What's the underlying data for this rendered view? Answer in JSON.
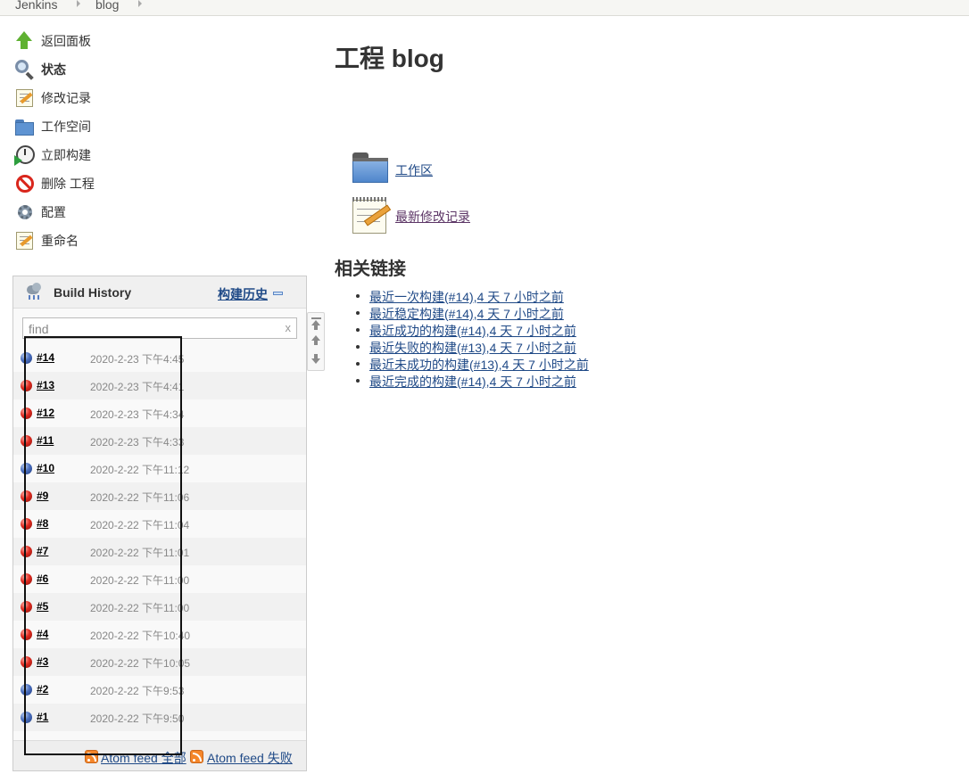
{
  "breadcrumb": [
    "Jenkins",
    "blog"
  ],
  "sidebar": {
    "tasks": [
      {
        "label": "返回面板",
        "icon": "up-arrow-icon",
        "bold": false
      },
      {
        "label": "状态",
        "icon": "magnifier-icon",
        "bold": true
      },
      {
        "label": "修改记录",
        "icon": "notepad-icon",
        "bold": false
      },
      {
        "label": "工作空间",
        "icon": "folder-icon",
        "bold": false
      },
      {
        "label": "立即构建",
        "icon": "clock-icon",
        "bold": false
      },
      {
        "label": "删除 工程",
        "icon": "no-entry-icon",
        "bold": false
      },
      {
        "label": "配置",
        "icon": "gear-icon",
        "bold": false
      },
      {
        "label": "重命名",
        "icon": "notepad-icon",
        "bold": false
      }
    ]
  },
  "build_history": {
    "title": "Build History",
    "trend_label": "构建历史",
    "find_placeholder": "find",
    "clear_label": "x",
    "builds": [
      {
        "number": "#14",
        "time": "2020-2-23 下午4:45",
        "status": "blue"
      },
      {
        "number": "#13",
        "time": "2020-2-23 下午4:41",
        "status": "red"
      },
      {
        "number": "#12",
        "time": "2020-2-23 下午4:34",
        "status": "red"
      },
      {
        "number": "#11",
        "time": "2020-2-23 下午4:33",
        "status": "red"
      },
      {
        "number": "#10",
        "time": "2020-2-22 下午11:12",
        "status": "blue"
      },
      {
        "number": "#9",
        "time": "2020-2-22 下午11:06",
        "status": "red"
      },
      {
        "number": "#8",
        "time": "2020-2-22 下午11:04",
        "status": "red"
      },
      {
        "number": "#7",
        "time": "2020-2-22 下午11:01",
        "status": "red"
      },
      {
        "number": "#6",
        "time": "2020-2-22 下午11:00",
        "status": "red"
      },
      {
        "number": "#5",
        "time": "2020-2-22 下午11:00",
        "status": "red"
      },
      {
        "number": "#4",
        "time": "2020-2-22 下午10:40",
        "status": "red"
      },
      {
        "number": "#3",
        "time": "2020-2-22 下午10:05",
        "status": "red"
      },
      {
        "number": "#2",
        "time": "2020-2-22 下午9:53",
        "status": "blue"
      },
      {
        "number": "#1",
        "time": "2020-2-22 下午9:50",
        "status": "blue"
      }
    ],
    "feed_all": "Atom feed 全部",
    "feed_failures": "Atom feed 失败"
  },
  "main": {
    "title": "工程 blog",
    "workspace_link": "工作区",
    "changes_link": "最新修改记录",
    "related_title": "相关链接",
    "related_links": [
      "最近一次构建(#14),4 天 7 小时之前",
      "最近稳定构建(#14),4 天 7 小时之前",
      "最近成功的构建(#14),4 天 7 小时之前",
      "最近失败的构建(#13),4 天 7 小时之前",
      "最近未成功的构建(#13),4 天 7 小时之前",
      "最近完成的构建(#14),4 天 7 小时之前"
    ]
  },
  "colors": {
    "link": "#204a87",
    "visited_link": "#5c3566",
    "success_ball": "#4a6fbe",
    "failure_ball": "#e02b20",
    "rss": "#f5862a"
  }
}
